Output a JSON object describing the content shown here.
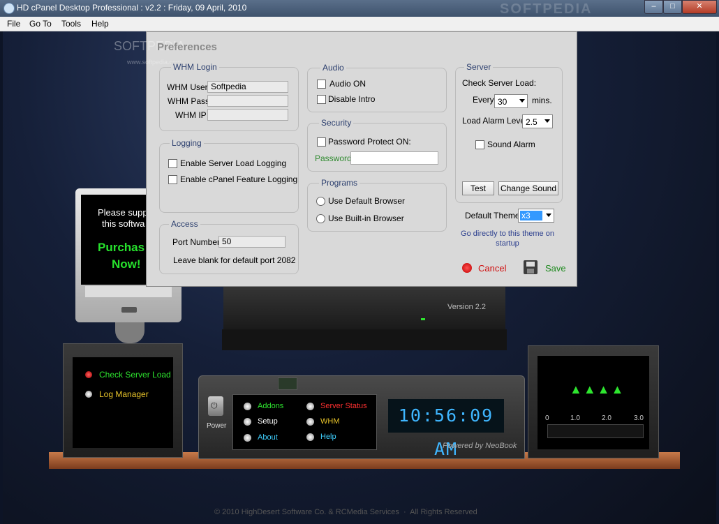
{
  "window": {
    "title": "HD cPanel Desktop Professional : v2.2 : Friday, 09 April, 2010",
    "watermark": "SOFTPEDIA"
  },
  "menu": [
    "File",
    "Go To",
    "Tools",
    "Help"
  ],
  "ad": {
    "line1": "Please supp",
    "line2": "this softwa",
    "purchase1": "Purchas",
    "purchase2": "Now!"
  },
  "version": "Version 2.2",
  "left_panel": {
    "items": [
      {
        "label": "Check Server Load",
        "color": "#2ee52f",
        "led": "#e02020"
      },
      {
        "label": "Log Manager",
        "color": "#e8c42a",
        "led": "#e8e8e8"
      }
    ]
  },
  "console": {
    "power_label": "Power",
    "buttons": [
      {
        "label": "Addons",
        "color": "#2ee52f"
      },
      {
        "label": "Server Status",
        "color": "#ff3030"
      },
      {
        "label": "Setup",
        "color": "#ffffff"
      },
      {
        "label": "WHM",
        "color": "#e8c42a"
      },
      {
        "label": "About",
        "color": "#3fd0ff"
      },
      {
        "label": "Help",
        "color": "#3fd0ff"
      }
    ],
    "clock": "10:56:09 AM",
    "powered_by": "Powered by NeoBook"
  },
  "gauge": {
    "ticks": [
      "0",
      "1.0",
      "2.0",
      "3.0"
    ]
  },
  "footer": "© 2010 HighDesert Software Co. & RCMedia Services  ·  All Rights Reserved",
  "dialog": {
    "watermark": "SOFTPEDIA",
    "watermark_url": "www.softpedia.com",
    "title": "Preferences",
    "whm": {
      "title": "WHM Login",
      "user_label": "WHM User",
      "user_value": "Softpedia",
      "pass_label": "WHM Pass",
      "pass_value": "",
      "ip_label": "WHM IP",
      "ip_value": ""
    },
    "logging": {
      "title": "Logging",
      "server_load": "Enable Server Load Logging",
      "feature": "Enable cPanel Feature Logging"
    },
    "access": {
      "title": "Access",
      "port_label": "Port Number",
      "port_value": "50",
      "note": "Leave blank for default port 2082"
    },
    "audio": {
      "title": "Audio",
      "audio_on": "Audio ON",
      "disable_intro": "Disable Intro"
    },
    "security": {
      "title": "Security",
      "protect": "Password Protect ON:",
      "password_label": "Password",
      "password_value": ""
    },
    "programs": {
      "title": "Programs",
      "default_browser": "Use Default Browser",
      "builtin_browser": "Use Built-in Browser"
    },
    "server": {
      "title": "Server",
      "check_label": "Check Server Load:",
      "every_label": "Every",
      "every_value": "30",
      "mins_label": "mins.",
      "alarm_level_label": "Load Alarm Level",
      "alarm_level_value": "2.5",
      "sound_alarm": "Sound Alarm",
      "test_button": "Test",
      "change_sound_button": "Change Sound"
    },
    "theme": {
      "label": "Default Theme",
      "value": "x3",
      "note1": "Go directly to this theme on",
      "note2": "startup"
    },
    "cancel": "Cancel",
    "save": "Save"
  }
}
